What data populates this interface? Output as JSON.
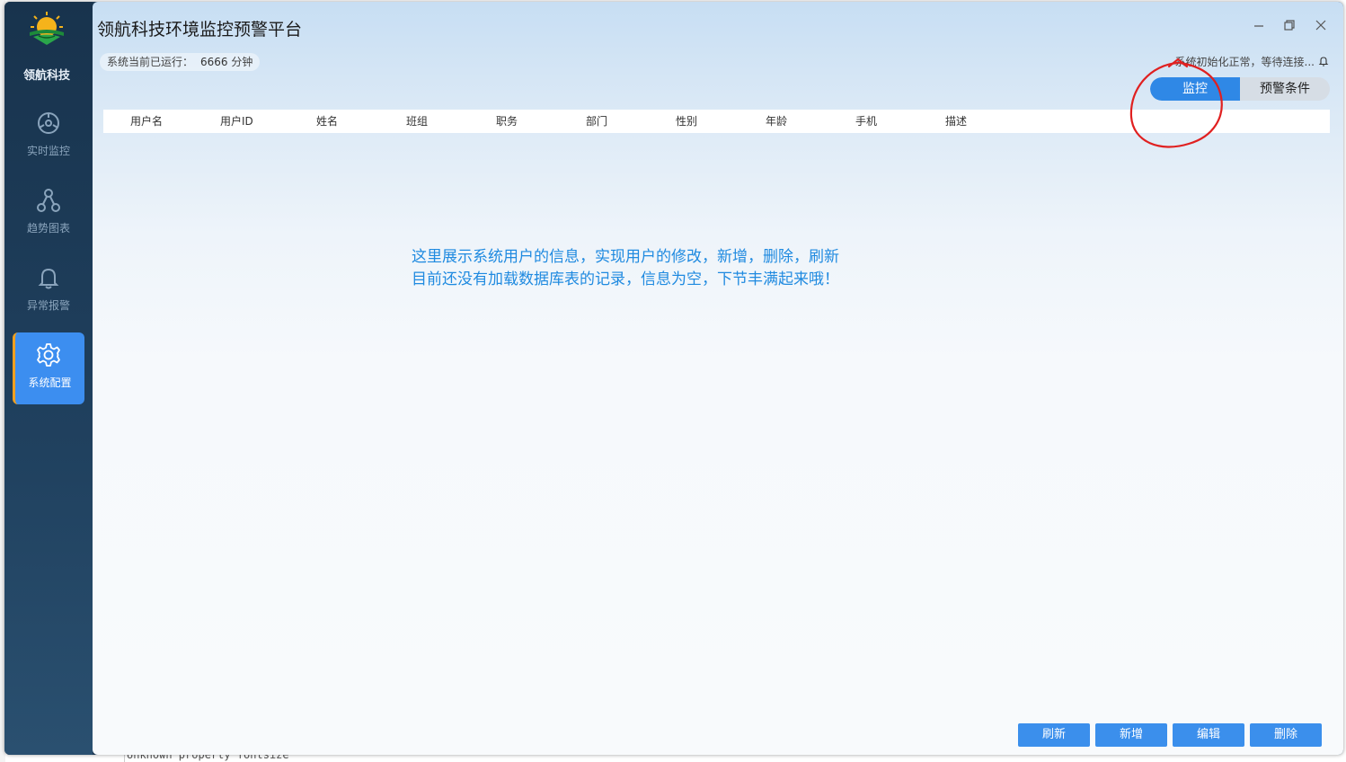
{
  "background": {
    "code_text": "Unknown property fontsize"
  },
  "window": {
    "title": "领航科技环境监控预警平台"
  },
  "sidebar": {
    "brand": "领航科技",
    "items": [
      {
        "label": "实时监控",
        "icon": "dashboard-icon"
      },
      {
        "label": "趋势图表",
        "icon": "network-nodes-icon"
      },
      {
        "label": "异常报警",
        "icon": "bell-icon"
      },
      {
        "label": "系统配置",
        "icon": "gear-icon",
        "active": true
      }
    ]
  },
  "header": {
    "runtime_label": "系统当前已运行：",
    "runtime_value": "6666",
    "runtime_unit": "分钟",
    "status": "系统初始化正常，等待连接..."
  },
  "tabs": {
    "active": "监控",
    "other": "预警条件"
  },
  "table": {
    "columns": [
      "用户名",
      "用户ID",
      "姓名",
      "班组",
      "职务",
      "部门",
      "性别",
      "年龄",
      "手机",
      "描述"
    ],
    "rows": []
  },
  "notice": {
    "line1": "这里展示系统用户的信息，实现用户的修改，新增，删除，刷新",
    "line2": "目前还没有加载数据库表的记录，信息为空，下节丰满起来哦！"
  },
  "actions": {
    "refresh": "刷新",
    "add": "新增",
    "edit": "编辑",
    "delete": "删除"
  },
  "colors": {
    "accent": "#2f88e6",
    "sidebar": "#1f3b55",
    "notice": "#1f8ae0",
    "annotation": "#e02020"
  }
}
